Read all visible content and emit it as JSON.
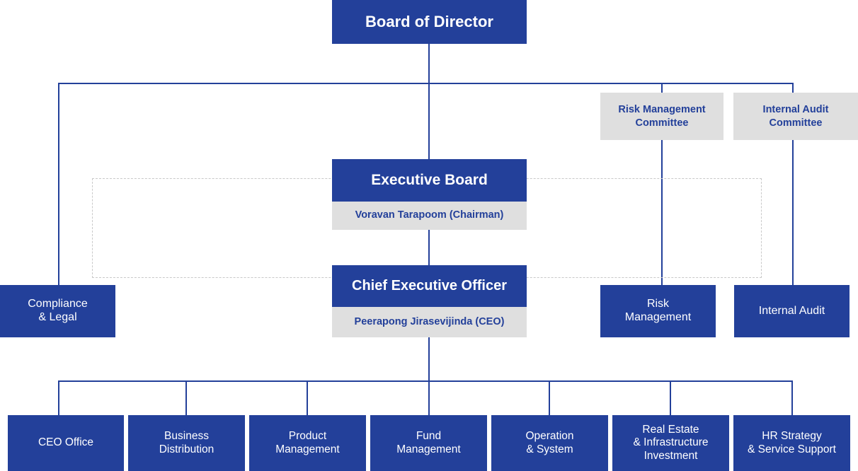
{
  "colors": {
    "primary_blue": "#23409A",
    "light_gray": "#dfdfdf",
    "dashed_border": "#c9c9c9",
    "white": "#ffffff"
  },
  "org_chart": {
    "board": {
      "title": "Board of Director"
    },
    "committees": [
      {
        "name": "risk-management-committee",
        "label": "Risk Management\nCommittee"
      },
      {
        "name": "internal-audit-committee",
        "label": "Internal Audit\nCommittee"
      }
    ],
    "executive_board": {
      "title": "Executive Board",
      "person": "Voravan Tarapoom (Chairman)"
    },
    "ceo": {
      "title": "Chief Executive Officer",
      "person": "Peerapong Jirasevijinda (CEO)"
    },
    "support_units": [
      {
        "name": "compliance-and-legal",
        "label": "Compliance\n& Legal"
      },
      {
        "name": "risk-management",
        "label": "Risk\nManagement"
      },
      {
        "name": "internal-audit",
        "label": "Internal Audit"
      }
    ],
    "departments": [
      {
        "name": "ceo-office",
        "label": "CEO Office"
      },
      {
        "name": "business-distribution",
        "label": "Business\nDistribution"
      },
      {
        "name": "product-management",
        "label": "Product\nManagement"
      },
      {
        "name": "fund-management",
        "label": "Fund\nManagement"
      },
      {
        "name": "operation-and-system",
        "label": "Operation\n& System"
      },
      {
        "name": "real-estate-and-infrastructure-investment",
        "label": "Real Estate\n& Infrastructure\nInvestment"
      },
      {
        "name": "hr-strategy-and-service-support",
        "label": "HR Strategy\n& Service Support"
      }
    ]
  }
}
